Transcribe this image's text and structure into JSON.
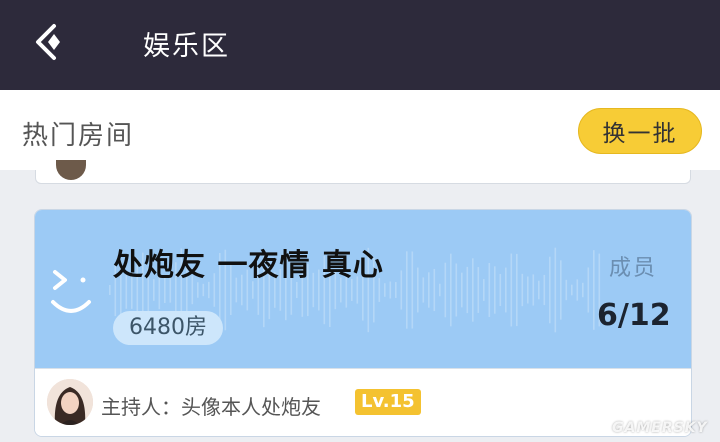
{
  "header": {
    "title": "娱乐区",
    "back_icon": "back-arrow-icon"
  },
  "hot_rooms": {
    "label": "热门房间",
    "refresh_label": "换一批"
  },
  "room": {
    "title": "处炮友 一夜情 真心",
    "room_id": "6480房",
    "members_label": "成员",
    "members_count": "6/12",
    "host_label": "主持人：头像本人处炮友",
    "host_level": "Lv.15"
  },
  "watermark": "GAMERSKY",
  "colors": {
    "topbar": "#2d2a3b",
    "accent": "#f7cc36",
    "card_blue": "#9ccaf5"
  }
}
